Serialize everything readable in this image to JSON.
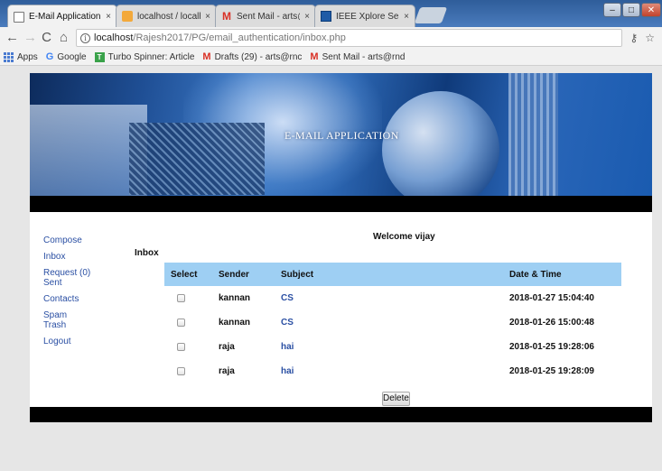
{
  "browser": {
    "tabs": [
      {
        "label": "E-Mail Application",
        "icon": "document-icon",
        "active": true
      },
      {
        "label": "localhost / localhost / gu",
        "icon": "phpmyadmin-icon",
        "active": false
      },
      {
        "label": "Sent Mail - arts@rndcen",
        "icon": "gmail-icon",
        "active": false
      },
      {
        "label": "IEEE Xplore Search Resu",
        "icon": "ieee-icon",
        "active": false
      }
    ],
    "tab_close_glyph": "×",
    "url_host": "localhost",
    "url_path": "/Rajesh2017/PG/email_authentication/inbox.php",
    "bookmarks": [
      {
        "label": "Apps",
        "icon": "apps-grid-icon"
      },
      {
        "label": "Google",
        "icon": "google-icon"
      },
      {
        "label": "Turbo Spinner: Article",
        "icon": "turbo-spinner-icon"
      },
      {
        "label": "Drafts (29) - arts@rnc",
        "icon": "gmail-icon"
      },
      {
        "label": "Sent Mail - arts@rnd",
        "icon": "gmail-icon"
      }
    ]
  },
  "app": {
    "banner_title": "E-MAIL APPLICATION",
    "welcome": "Welcome vijay",
    "inbox_heading": "Inbox",
    "sidebar": [
      {
        "label": "Compose"
      },
      {
        "label": "Inbox"
      },
      {
        "label": "Request (0)"
      },
      {
        "label": "Sent"
      },
      {
        "label": "Contacts"
      },
      {
        "label": "Spam"
      },
      {
        "label": "Trash"
      },
      {
        "label": "Logout"
      }
    ],
    "table": {
      "headers": {
        "select": "Select",
        "sender": "Sender",
        "subject": "Subject",
        "date": "Date & Time"
      },
      "rows": [
        {
          "sender": "kannan",
          "subject": "CS",
          "date": "2018-01-27 15:04:40"
        },
        {
          "sender": "kannan",
          "subject": "CS",
          "date": "2018-01-26 15:00:48"
        },
        {
          "sender": "raja",
          "subject": "hai",
          "date": "2018-01-25 19:28:06"
        },
        {
          "sender": "raja",
          "subject": "hai",
          "date": "2018-01-25 19:28:09"
        }
      ]
    },
    "delete_label": "Delete",
    "colors": {
      "header_bg": "#9ecff3",
      "link": "#2a4fa3",
      "strip": "#000000"
    }
  }
}
